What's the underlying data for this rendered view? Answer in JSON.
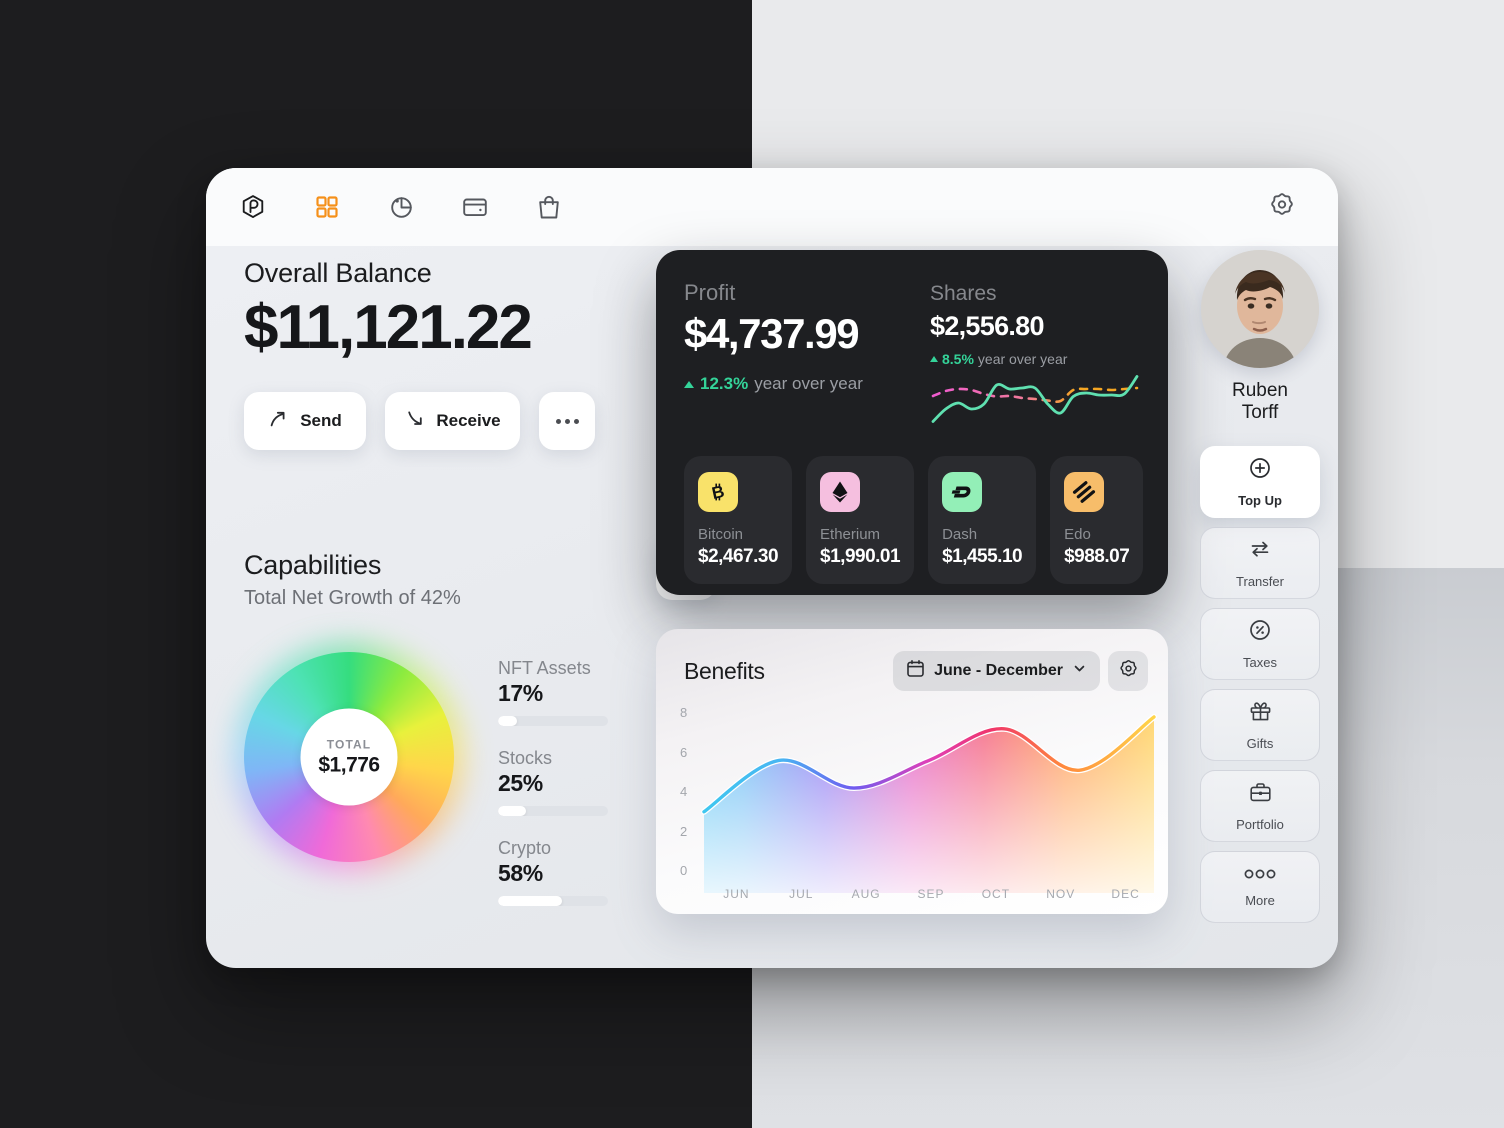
{
  "background": {
    "dark": "#1d1d1f",
    "light": "#e9eaec"
  },
  "topbar": {
    "logo_icon": "hexagon-logo-icon",
    "nav": [
      {
        "name": "dashboard",
        "icon": "grid-icon",
        "active": true
      },
      {
        "name": "analytics",
        "icon": "pie-chart-icon",
        "active": false
      },
      {
        "name": "wallet",
        "icon": "wallet-icon",
        "active": false
      },
      {
        "name": "shop",
        "icon": "shopping-bag-icon",
        "active": false
      }
    ],
    "settings_icon": "gear-icon",
    "accent": "#f59019"
  },
  "balance": {
    "label": "Overall Balance",
    "amount": "$11,121.22",
    "buttons": [
      {
        "label": "Send",
        "icon": "arrow-up-right-icon"
      },
      {
        "label": "Receive",
        "icon": "arrow-down-right-icon"
      },
      {
        "label": "",
        "icon": "more-dots-icon"
      }
    ]
  },
  "capabilities": {
    "title": "Capabilities",
    "subtitle": "Total Net Growth of 42%",
    "chart_toggle_icon": "bar-chart-icon",
    "donut": {
      "center_label": "TOTAL",
      "center_value": "$1,776"
    },
    "legend": [
      {
        "name": "NFT Assets",
        "value": "17%",
        "pct": 17
      },
      {
        "name": "Stocks",
        "value": "25%",
        "pct": 25
      },
      {
        "name": "Crypto",
        "value": "58%",
        "pct": 58
      }
    ]
  },
  "profit_card": {
    "profit_label": "Profit",
    "profit_value": "$4,737.99",
    "profit_delta": "12.3%",
    "profit_delta_suffix": "year over year",
    "shares_label": "Shares",
    "shares_value": "$2,556.80",
    "shares_delta": "8.5%",
    "shares_delta_suffix": "year over year",
    "delta_color": "#34d399",
    "coins": [
      {
        "name": "Bitcoin",
        "value": "$2,467.30",
        "icon": "bitcoin-icon",
        "bg": "#f9e26a",
        "fg": "#111214"
      },
      {
        "name": "Etherium",
        "value": "$1,990.01",
        "icon": "ethereum-icon",
        "bg": "#f5bfdf",
        "fg": "#111214"
      },
      {
        "name": "Dash",
        "value": "$1,455.10",
        "icon": "dash-icon",
        "bg": "#93efb7",
        "fg": "#111214"
      },
      {
        "name": "Edo",
        "value": "$988.07",
        "icon": "edo-icon",
        "bg": "#f7bd6a",
        "fg": "#111214"
      }
    ]
  },
  "benefits": {
    "title": "Benefits",
    "range_label": "June - December",
    "range_icon": "calendar-icon",
    "chevron_icon": "chevron-down-icon",
    "gear_icon": "gear-icon"
  },
  "chart_data": {
    "type": "area",
    "title": "Benefits",
    "categories": [
      "JUN",
      "JUL",
      "AUG",
      "SEP",
      "OCT",
      "NOV",
      "DEC"
    ],
    "values": [
      3.0,
      5.6,
      4.2,
      5.6,
      7.2,
      5.1,
      7.8
    ],
    "ylabel": "",
    "xlabel": "",
    "yticks": [
      0,
      2,
      4,
      6,
      8
    ],
    "ylim": [
      0,
      8
    ],
    "grid": false,
    "legend": "none",
    "line_gradient": [
      "#3fc7f0",
      "#6f5cf0",
      "#e040b8",
      "#f0356a",
      "#ff8a3d",
      "#ffd54a"
    ]
  },
  "shares_sparkline": {
    "type": "line",
    "series": [
      {
        "name": "solid",
        "color": "#5fe0b0",
        "style": "solid",
        "values": [
          0.05,
          0.3,
          0.42,
          0.3,
          0.4,
          0.78,
          0.7,
          0.72,
          0.72,
          0.4,
          0.22,
          0.55,
          0.62,
          0.58,
          0.58,
          0.6,
          0.95
        ]
      },
      {
        "name": "dashed",
        "color_start": "#f05bd0",
        "color_end": "#f5a623",
        "style": "dashed",
        "values": [
          0.56,
          0.66,
          0.7,
          0.68,
          0.6,
          0.55,
          0.56,
          0.52,
          0.5,
          0.47,
          0.46,
          0.68,
          0.7,
          0.7,
          0.68,
          0.7,
          0.72
        ]
      }
    ]
  },
  "user": {
    "name_line1": "Ruben",
    "name_line2": "Torff",
    "avatar_name": "avatar"
  },
  "rail": [
    {
      "label": "Top Up",
      "icon": "plus-circle-icon",
      "active": true
    },
    {
      "label": "Transfer",
      "icon": "transfer-icon",
      "active": false
    },
    {
      "label": "Taxes",
      "icon": "percent-circle-icon",
      "active": false
    },
    {
      "label": "Gifts",
      "icon": "gift-icon",
      "active": false
    },
    {
      "label": "Portfolio",
      "icon": "briefcase-icon",
      "active": false
    },
    {
      "label": "More",
      "icon": "three-circles-icon",
      "active": false
    }
  ]
}
